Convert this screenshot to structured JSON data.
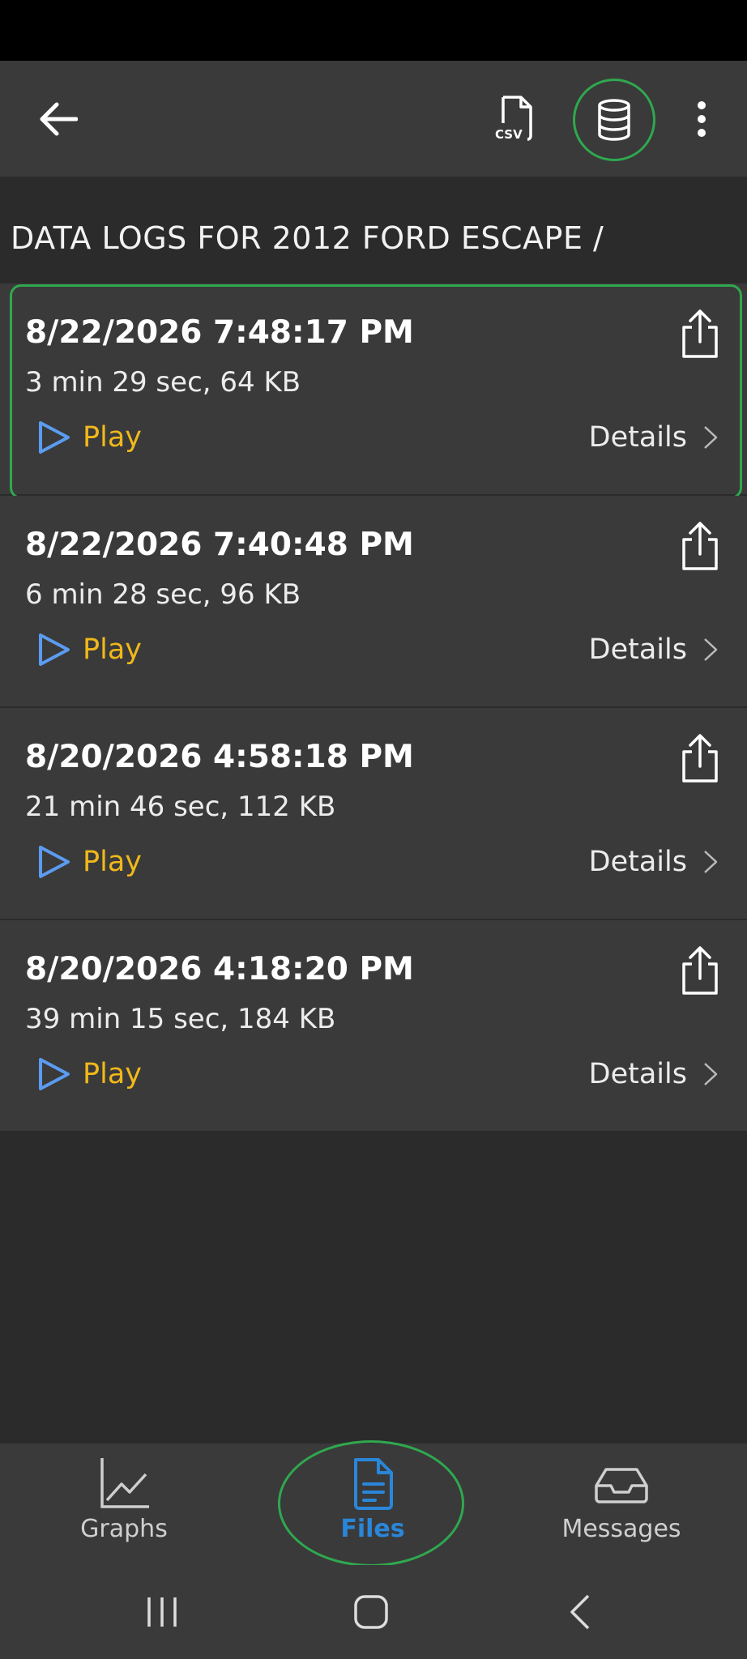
{
  "app_bar": {
    "back_icon": "arrow-left-icon",
    "csv_icon": "csv-file-icon",
    "csv_text": "CSV",
    "database_icon": "database-icon",
    "more_icon": "more-vertical-icon"
  },
  "section": {
    "title": "DATA LOGS FOR 2012 FORD ESCAPE /"
  },
  "logs": [
    {
      "timestamp": "8/22/2026 7:48:17 PM",
      "summary": "3 min 29 sec, 64 KB",
      "play_label": "Play",
      "details_label": "Details",
      "selected": true
    },
    {
      "timestamp": "8/22/2026 7:40:48 PM",
      "summary": "6 min 28 sec, 96 KB",
      "play_label": "Play",
      "details_label": "Details",
      "selected": false
    },
    {
      "timestamp": "8/20/2026 4:58:18 PM",
      "summary": "21 min 46 sec, 112 KB",
      "play_label": "Play",
      "details_label": "Details",
      "selected": false
    },
    {
      "timestamp": "8/20/2026 4:18:20 PM",
      "summary": "39 min 15 sec, 184 KB",
      "play_label": "Play",
      "details_label": "Details",
      "selected": false
    }
  ],
  "bottom_nav": {
    "items": [
      {
        "label": "Graphs",
        "icon": "line-chart-icon",
        "active": false
      },
      {
        "label": "Files",
        "icon": "file-icon",
        "active": true
      },
      {
        "label": "Messages",
        "icon": "inbox-icon",
        "active": false
      }
    ]
  },
  "colors": {
    "accent_green": "#2fa84f",
    "play_yellow": "#f0b81a",
    "play_icon_blue": "#5b9cf0",
    "active_blue": "#2a86d9",
    "surface": "#3a3a3a",
    "background": "#2b2b2b"
  }
}
